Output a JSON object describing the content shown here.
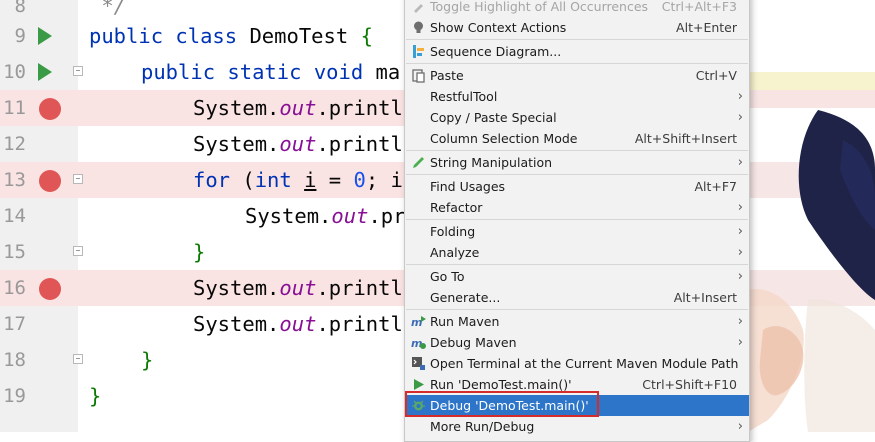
{
  "editor": {
    "lines": [
      {
        "num": "8",
        "code": " */"
      },
      {
        "num": "9"
      },
      {
        "num": "10"
      },
      {
        "num": "11"
      },
      {
        "num": "12"
      },
      {
        "num": "13"
      },
      {
        "num": "14"
      },
      {
        "num": "15"
      },
      {
        "num": "16"
      },
      {
        "num": "17"
      },
      {
        "num": "18"
      },
      {
        "num": "19"
      }
    ],
    "tokens": {
      "public": "public",
      "class": "class",
      "class_name": "DemoTest",
      "open_brace": "{",
      "close_brace": "}",
      "static": "static",
      "void": "void",
      "main_fragment": "ma",
      "system": "System.",
      "out": "out",
      "print_frag": ".printl",
      "print_frag_short": ".pr",
      "for": "for",
      "paren_open": "(",
      "int": "int",
      "var_i": "i",
      "eq": " = ",
      "zero": "0",
      "semi_i": "; i"
    }
  },
  "menu": {
    "items": [
      {
        "label": "Toggle Highlight of All Occurrences",
        "shortcut": "Ctrl+Alt+F3",
        "icon": "highlight-icon",
        "disabled": true
      },
      {
        "label": "Show Context Actions",
        "shortcut": "Alt+Enter",
        "icon": "bulb-icon"
      },
      {
        "label": "Sequence Diagram...",
        "shortcut": "",
        "icon": "sequence-diagram-icon"
      },
      {
        "label": "Paste",
        "shortcut": "Ctrl+V",
        "icon": "paste-icon"
      },
      {
        "label": "RestfulTool",
        "shortcut": "",
        "submenu": true
      },
      {
        "label": "Copy / Paste Special",
        "shortcut": "",
        "submenu": true
      },
      {
        "label": "Column Selection Mode",
        "shortcut": "Alt+Shift+Insert"
      },
      {
        "label": "String Manipulation",
        "shortcut": "",
        "icon": "pencil-icon",
        "submenu": true
      },
      {
        "label": "Find Usages",
        "shortcut": "Alt+F7"
      },
      {
        "label": "Refactor",
        "shortcut": "",
        "submenu": true
      },
      {
        "label": "Folding",
        "shortcut": "",
        "submenu": true
      },
      {
        "label": "Analyze",
        "shortcut": "",
        "submenu": true
      },
      {
        "label": "Go To",
        "shortcut": "",
        "submenu": true
      },
      {
        "label": "Generate...",
        "shortcut": "Alt+Insert"
      },
      {
        "label": "Run Maven",
        "shortcut": "",
        "icon": "maven-run-icon",
        "submenu": true
      },
      {
        "label": "Debug Maven",
        "shortcut": "",
        "icon": "maven-debug-icon",
        "submenu": true
      },
      {
        "label": "Open Terminal at the Current Maven Module Path",
        "shortcut": "",
        "icon": "terminal-icon"
      },
      {
        "label": "Run 'DemoTest.main()'",
        "shortcut": "Ctrl+Shift+F10",
        "icon": "run-icon"
      },
      {
        "label": "Debug 'DemoTest.main()'",
        "shortcut": "",
        "icon": "debug-icon",
        "selected": true
      },
      {
        "label": "More Run/Debug",
        "shortcut": "",
        "submenu": true
      }
    ],
    "submenu_arrow": "›"
  },
  "colors": {
    "keyword": "#0033b3",
    "static_field": "#871094",
    "number": "#1750eb",
    "selection": "#2c75c8",
    "breakpoint": "#e05555",
    "run_gutter": "#3a9a45",
    "highlight_box": "#d62b2b"
  }
}
